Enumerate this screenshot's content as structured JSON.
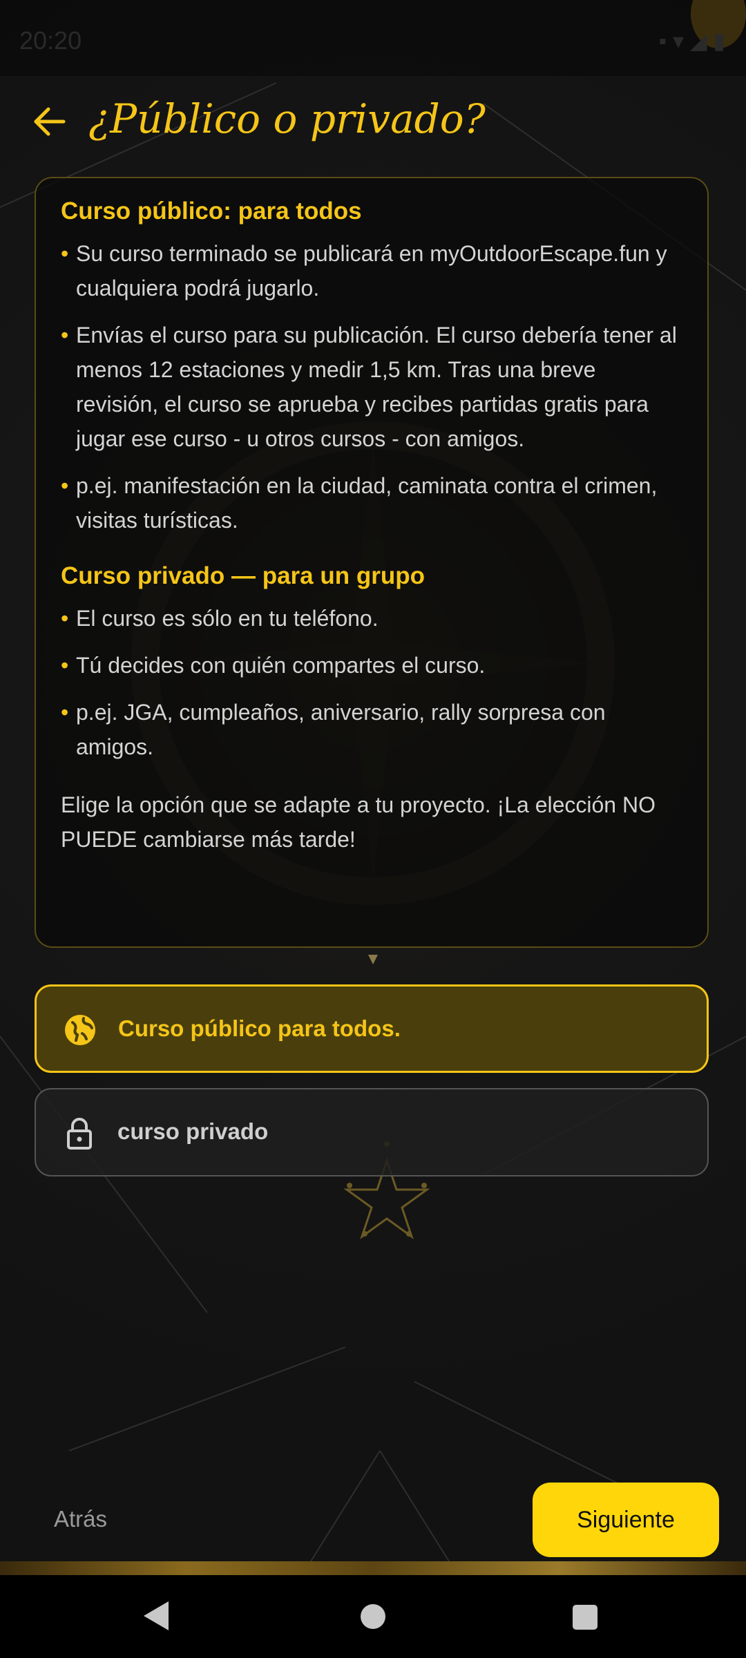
{
  "status_bar": {
    "time": "20:20",
    "icons": [
      "notification-icon",
      "wifi-icon",
      "signal-icon",
      "battery-icon"
    ]
  },
  "header": {
    "title": "¿Público o privado?"
  },
  "info": {
    "public_title": "Curso público: para todos",
    "public_bullets": [
      "Su curso terminado se publicará en myOutdoorEscape.fun y cualquiera podrá jugarlo.",
      "Envías el curso para su publicación. El curso debería tener al menos 12 estaciones y medir 1,5 km. Tras una breve revisión, el curso se aprueba y recibes partidas gratis para jugar ese curso - u otros cursos - con amigos.",
      "p.ej. manifestación en la ciudad, caminata contra el crimen, visitas turísticas."
    ],
    "private_title": "Curso privado — para un grupo",
    "private_bullets": [
      "El curso es sólo en tu teléfono.",
      "Tú decides con quién compartes el curso.",
      "p.ej. JGA, cumpleaños, aniversario, rally sorpresa con amigos."
    ],
    "closing": "Elige la opción que se adapte a tu proyecto. ¡La elección NO PUEDE cambiarse más tarde!"
  },
  "options": {
    "public_label": "Curso público para todos.",
    "private_label": "curso privado",
    "selected": "public"
  },
  "actions": {
    "back_label": "Atrás",
    "next_label": "Siguiente"
  },
  "colors": {
    "accent": "#f5c518",
    "button": "#ffd60a",
    "background": "#141414"
  }
}
